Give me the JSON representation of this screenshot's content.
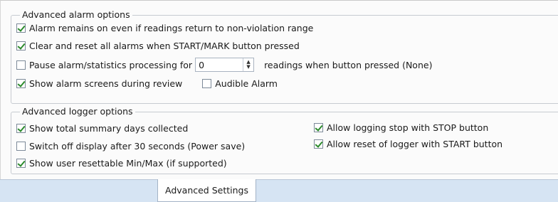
{
  "alarm_group": {
    "legend": "Advanced alarm options",
    "remain_on": {
      "label": "Alarm remains on even if readings return to non-violation range",
      "checked": true
    },
    "clear_reset": {
      "label": "Clear and reset all alarms when START/MARK button pressed",
      "checked": true
    },
    "pause": {
      "label": "Pause alarm/statistics processing for",
      "checked": false,
      "value": "0",
      "suffix": "readings when button pressed (None)"
    },
    "show_screens": {
      "label": "Show alarm screens during review",
      "checked": true
    },
    "audible": {
      "label": "Audible Alarm",
      "checked": false
    }
  },
  "logger_group": {
    "legend": "Advanced logger options",
    "summary_days": {
      "label": "Show total summary days collected",
      "checked": true
    },
    "switch_off": {
      "label": "Switch off display after 30 seconds (Power save)",
      "checked": false
    },
    "min_max": {
      "label": "Show user resettable Min/Max (if supported)",
      "checked": true
    },
    "stop_button": {
      "label": "Allow logging stop with STOP button",
      "checked": true
    },
    "reset_start": {
      "label": "Allow reset of logger with START button",
      "checked": true
    }
  },
  "tabs": [
    {
      "label": "Advanced Settings",
      "active": true
    }
  ],
  "colors": {
    "check": "#2b8a2b",
    "tabbar": "#d6e4f3",
    "group_border": "#c7cbd1"
  },
  "icons": {
    "checkbox_check": "checkmark-icon",
    "spinner": "spin-arrows-icon"
  }
}
